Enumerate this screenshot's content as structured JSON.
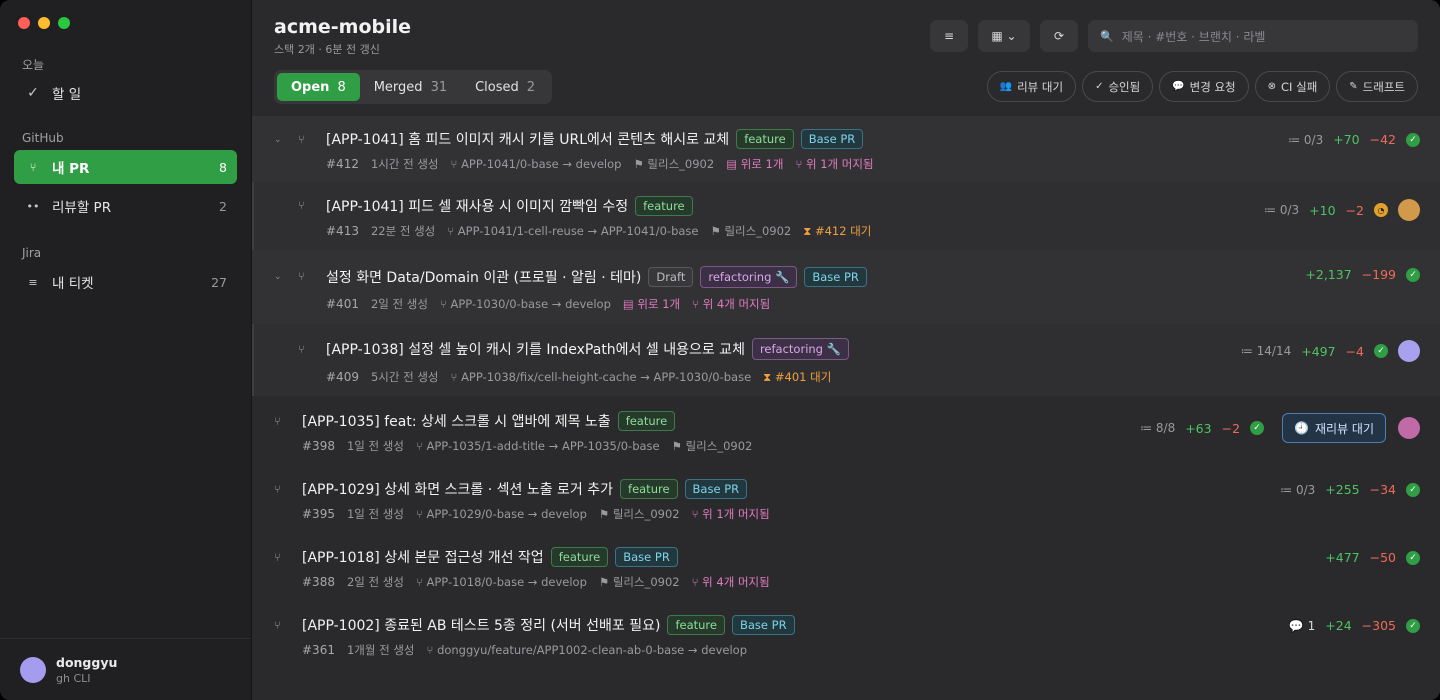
{
  "sidebar": {
    "today_section": "오늘",
    "todo": {
      "icon": "checkmark-icon",
      "label": "할 일"
    },
    "github_section": "GitHub",
    "my_pr": {
      "label": "내 PR",
      "count": "8"
    },
    "to_review": {
      "label": "리뷰할 PR",
      "count": "2"
    },
    "jira_section": "Jira",
    "my_tickets": {
      "label": "내 티켓",
      "count": "27"
    },
    "user": {
      "name": "donggyu",
      "sub": "gh CLI"
    }
  },
  "header": {
    "title": "acme-mobile",
    "subtitle": "스택 2개 · 6분 전 갱신",
    "search_placeholder": "제목 · #번호 · 브랜치 · 라벨"
  },
  "tabs": [
    {
      "label": "Open",
      "count": "8"
    },
    {
      "label": "Merged",
      "count": "31"
    },
    {
      "label": "Closed",
      "count": "2"
    }
  ],
  "filters": {
    "review_wait": "리뷰 대기",
    "approved": "승인됨",
    "changes_requested": "변경 요청",
    "ci_failed": "CI 실패",
    "draft": "드래프트"
  },
  "prs": [
    {
      "title": "[APP-1041] 홈 피드 이미지 캐시 키를 URL에서 콘텐츠 해시로 교체",
      "tags": [
        "feature",
        "Base PR"
      ],
      "number": "#412",
      "age": "1시간 전 생성",
      "branch": "APP-1041/0-base → develop",
      "milestone": "릴리스_0902",
      "stack_up": "위로 1개",
      "merged_above": "위 1개 머지됨",
      "review": "0/3",
      "additions": "+70",
      "deletions": "−42"
    },
    {
      "title": "[APP-1041] 피드 셀 재사용 시 이미지 깜빡임 수정",
      "tags": [
        "feature"
      ],
      "number": "#413",
      "age": "22분 전 생성",
      "branch": "APP-1041/1-cell-reuse → APP-1041/0-base",
      "milestone": "릴리스_0902",
      "waiting": "#412 대기",
      "review": "0/3",
      "additions": "+10",
      "deletions": "−2"
    },
    {
      "title": "설정 화면 Data/Domain 이관 (프로필 · 알림 · 테마)",
      "tags": [
        "Draft",
        "refactoring 🔧",
        "Base PR"
      ],
      "number": "#401",
      "age": "2일 전 생성",
      "branch": "APP-1030/0-base → develop",
      "stack_up": "위로 1개",
      "merged_above": "위 4개 머지됨",
      "additions": "+2,137",
      "deletions": "−199"
    },
    {
      "title": "[APP-1038] 설정 셀 높이 캐시 키를 IndexPath에서 셀 내용으로 교체",
      "tags": [
        "refactoring 🔧"
      ],
      "number": "#409",
      "age": "5시간 전 생성",
      "branch": "APP-1038/fix/cell-height-cache → APP-1030/0-base",
      "waiting": "#401 대기",
      "review": "14/14",
      "additions": "+497",
      "deletions": "−4"
    },
    {
      "title": "[APP-1035] feat: 상세 스크롤 시 앱바에 제목 노출",
      "tags": [
        "feature"
      ],
      "number": "#398",
      "age": "1일 전 생성",
      "branch": "APP-1035/1-add-title → APP-1035/0-base",
      "milestone": "릴리스_0902",
      "review": "8/8",
      "additions": "+63",
      "deletions": "−2",
      "rereview": "재리뷰 대기"
    },
    {
      "title": "[APP-1029] 상세 화면 스크롤 · 섹션 노출 로거 추가",
      "tags": [
        "feature",
        "Base PR"
      ],
      "number": "#395",
      "age": "1일 전 생성",
      "branch": "APP-1029/0-base → develop",
      "milestone": "릴리스_0902",
      "merged_above": "위 1개 머지됨",
      "review": "0/3",
      "additions": "+255",
      "deletions": "−34"
    },
    {
      "title": "[APP-1018] 상세 본문 접근성 개선 작업",
      "tags": [
        "feature",
        "Base PR"
      ],
      "number": "#388",
      "age": "2일 전 생성",
      "branch": "APP-1018/0-base → develop",
      "milestone": "릴리스_0902",
      "merged_above": "위 4개 머지됨",
      "additions": "+477",
      "deletions": "−50"
    },
    {
      "title": "[APP-1002] 종료된 AB 테스트 5종 정리 (서버 선배포 필요)",
      "tags": [
        "feature",
        "Base PR"
      ],
      "number": "#361",
      "age": "1개월 전 생성",
      "branch": "donggyu/feature/APP1002-clean-ab-0-base → develop",
      "comments": "1",
      "additions": "+24",
      "deletions": "−305"
    }
  ]
}
